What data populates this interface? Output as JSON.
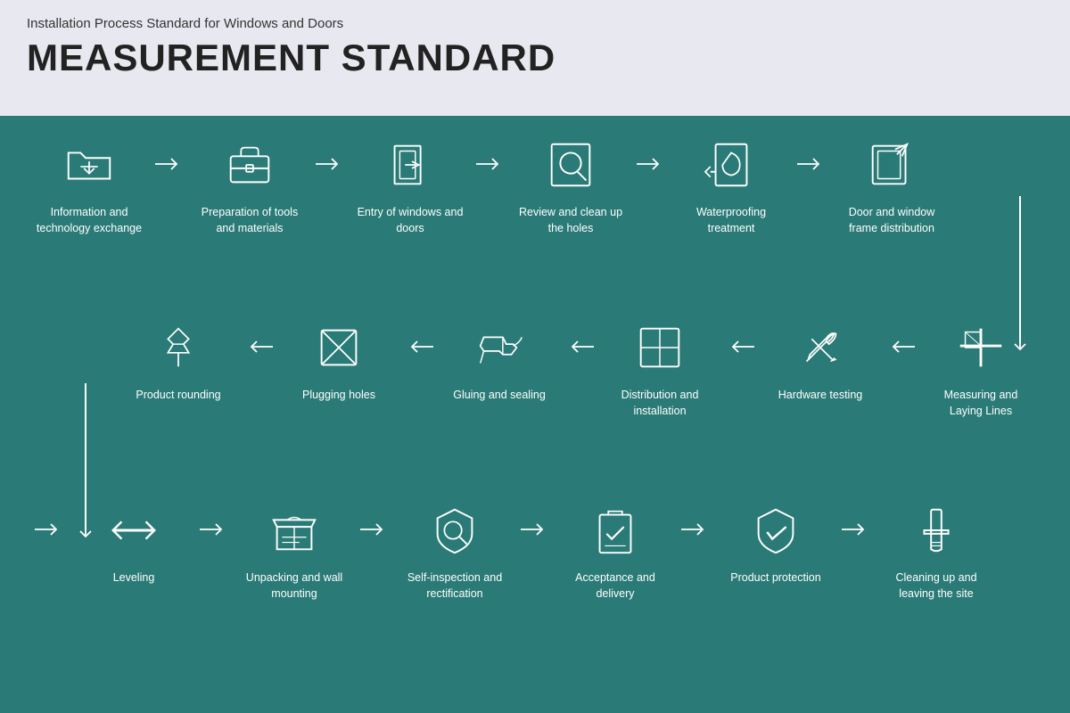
{
  "header": {
    "subtitle": "Installation Process Standard for Windows and Doors",
    "title": "MEASUREMENT STANDARD"
  },
  "row1": [
    {
      "id": "info-tech",
      "label": "Information and technology exchange"
    },
    {
      "id": "prep-tools",
      "label": "Preparation of tools and materials"
    },
    {
      "id": "entry-windows",
      "label": "Entry of windows and doors"
    },
    {
      "id": "review-holes",
      "label": "Review and clean up the holes"
    },
    {
      "id": "waterproofing",
      "label": "Waterproofing treatment"
    },
    {
      "id": "frame-dist",
      "label": "Door and window frame distribution"
    }
  ],
  "row2": [
    {
      "id": "measuring",
      "label": "Measuring and Laying Lines"
    },
    {
      "id": "hardware",
      "label": "Hardware testing"
    },
    {
      "id": "dist-install",
      "label": "Distribution and installation"
    },
    {
      "id": "gluing",
      "label": "Gluing and sealing"
    },
    {
      "id": "plugging",
      "label": "Plugging holes"
    },
    {
      "id": "product-round",
      "label": "Product rounding"
    }
  ],
  "row3": [
    {
      "id": "leveling",
      "label": "Leveling"
    },
    {
      "id": "unpacking",
      "label": "Unpacking and wall mounting"
    },
    {
      "id": "self-inspect",
      "label": "Self-inspection and rectification"
    },
    {
      "id": "acceptance",
      "label": "Acceptance and delivery"
    },
    {
      "id": "product-protect",
      "label": "Product protection"
    },
    {
      "id": "cleaning",
      "label": "Cleaning up and leaving the site"
    }
  ]
}
